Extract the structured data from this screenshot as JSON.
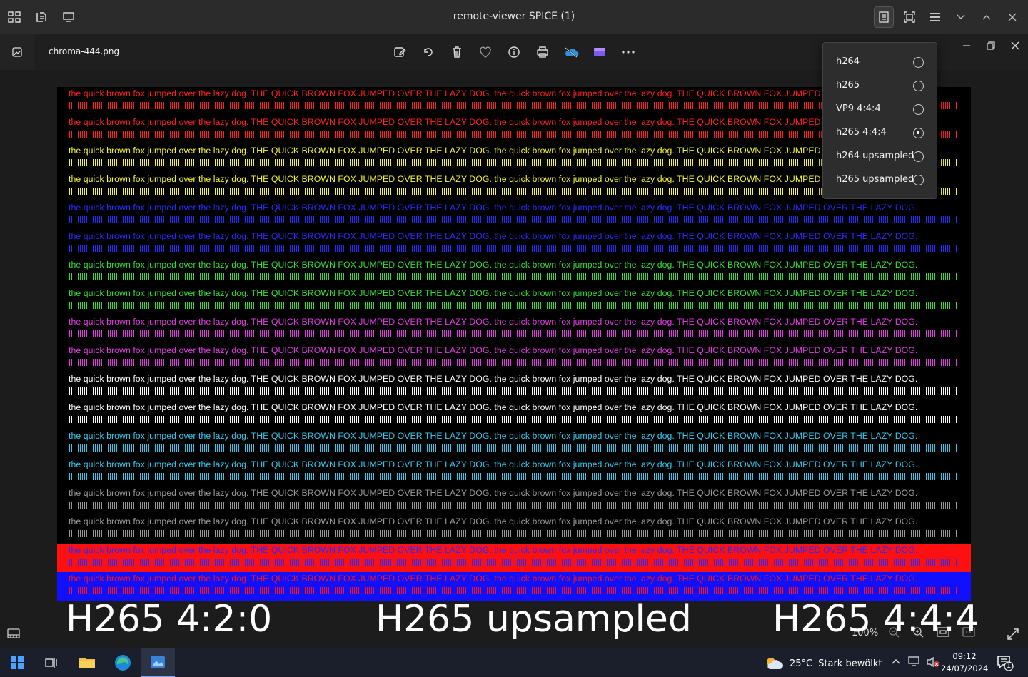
{
  "window": {
    "title": "remote-viewer SPICE (1)"
  },
  "photos_app": {
    "filename": "chroma-444.png",
    "zoom": "100%"
  },
  "test_pattern": {
    "sentence": "the quick brown fox jumped over the lazy dog. THE QUICK BROWN FOX JUMPED OVER THE LAZY DOG. the quick brown fox jumped over the lazy dog. THE QUICK BROWN FOX JUMPED OVER THE LAZY DOG.",
    "rows": [
      {
        "text_color": "#ff2020",
        "bg": "#000000"
      },
      {
        "text_color": "#ff2020",
        "bg": "#000000"
      },
      {
        "text_color": "#f4f430",
        "bg": "#000000"
      },
      {
        "text_color": "#f4f430",
        "bg": "#000000"
      },
      {
        "text_color": "#2a2aff",
        "bg": "#000000"
      },
      {
        "text_color": "#2a2aff",
        "bg": "#000000"
      },
      {
        "text_color": "#33dd33",
        "bg": "#000000"
      },
      {
        "text_color": "#33dd33",
        "bg": "#000000"
      },
      {
        "text_color": "#e43ae4",
        "bg": "#000000"
      },
      {
        "text_color": "#e43ae4",
        "bg": "#000000"
      },
      {
        "text_color": "#ffffff",
        "bg": "#000000"
      },
      {
        "text_color": "#ffffff",
        "bg": "#000000"
      },
      {
        "text_color": "#33c8ee",
        "bg": "#000000"
      },
      {
        "text_color": "#33c8ee",
        "bg": "#000000"
      },
      {
        "text_color": "#9a9a9a",
        "bg": "#000000"
      },
      {
        "text_color": "#9a9a9a",
        "bg": "#000000"
      },
      {
        "text_color": "#2a2aff",
        "bg": "#ff1010"
      },
      {
        "text_color": "#ff1010",
        "bg": "#1010ff"
      }
    ]
  },
  "captions": {
    "left": "H265 4:2:0",
    "center": "H265 upsampled",
    "right": "H265 4:4:4"
  },
  "codec_menu": {
    "items": [
      {
        "label": "h264",
        "selected": false
      },
      {
        "label": "h265",
        "selected": false
      },
      {
        "label": "VP9 4:4:4",
        "selected": false
      },
      {
        "label": "h265 4:4:4",
        "selected": true
      },
      {
        "label": "h264 upsampled",
        "selected": false
      },
      {
        "label": "h265 upsampled",
        "selected": false
      }
    ]
  },
  "taskbar": {
    "weather_temp": "25°C",
    "weather_text": "Stark bewölkt",
    "time": "09:12",
    "date": "24/07/2024",
    "notifications": "1"
  }
}
